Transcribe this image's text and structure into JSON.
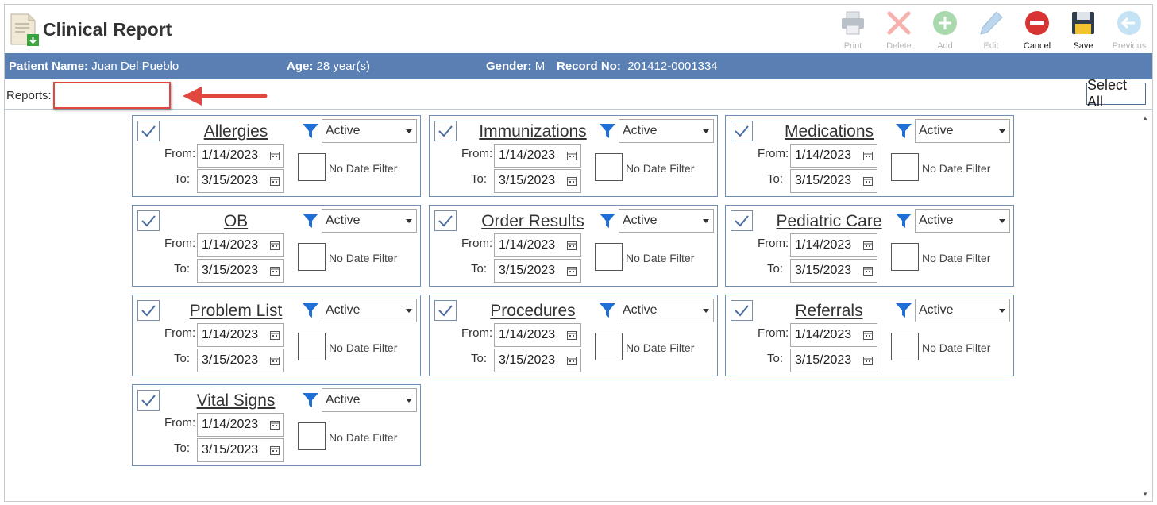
{
  "app": {
    "title": "Clinical Report"
  },
  "toolbar": {
    "buttons": [
      {
        "label": "Print",
        "icon": "printer-icon",
        "enabled": false
      },
      {
        "label": "Delete",
        "icon": "delete-x-icon",
        "enabled": false
      },
      {
        "label": "Add",
        "icon": "add-plus-icon",
        "enabled": false
      },
      {
        "label": "Edit",
        "icon": "pencil-icon",
        "enabled": false
      },
      {
        "label": "Cancel",
        "icon": "cancel-icon",
        "enabled": true
      },
      {
        "label": "Save",
        "icon": "floppy-disk-icon",
        "enabled": true
      },
      {
        "label": "Previous",
        "icon": "back-arrow-icon",
        "enabled": false
      }
    ]
  },
  "patient": {
    "name_label": "Patient Name:",
    "name": "Juan Del Pueblo",
    "age_label": "Age:",
    "age": "28 year(s)",
    "gender_label": "Gender:",
    "gender": "M",
    "record_label": "Record No:",
    "record": "201412-0001334"
  },
  "reports": {
    "label": "Reports:",
    "value": "",
    "select_all": "Select All"
  },
  "from_label": "From:",
  "to_label": "To:",
  "no_date_filter_label": "No Date Filter",
  "cards": [
    {
      "title": "Allergies",
      "checked": true,
      "status": "Active",
      "from": "1/14/2023",
      "to": "3/15/2023"
    },
    {
      "title": "Immunizations",
      "checked": true,
      "status": "Active",
      "from": "1/14/2023",
      "to": "3/15/2023"
    },
    {
      "title": "Medications",
      "checked": true,
      "status": "Active",
      "from": "1/14/2023",
      "to": "3/15/2023"
    },
    {
      "title": "OB",
      "checked": true,
      "status": "Active",
      "from": "1/14/2023",
      "to": "3/15/2023"
    },
    {
      "title": "Order Results",
      "checked": true,
      "status": "Active",
      "from": "1/14/2023",
      "to": "3/15/2023"
    },
    {
      "title": "Pediatric Care",
      "checked": true,
      "status": "Active",
      "from": "1/14/2023",
      "to": "3/15/2023"
    },
    {
      "title": "Problem List",
      "checked": true,
      "status": "Active",
      "from": "1/14/2023",
      "to": "3/15/2023"
    },
    {
      "title": "Procedures",
      "checked": true,
      "status": "Active",
      "from": "1/14/2023",
      "to": "3/15/2023"
    },
    {
      "title": "Referrals",
      "checked": true,
      "status": "Active",
      "from": "1/14/2023",
      "to": "3/15/2023"
    },
    {
      "title": "Vital Signs",
      "checked": true,
      "status": "Active",
      "from": "1/14/2023",
      "to": "3/15/2023"
    }
  ],
  "colors": {
    "header_bar": "#5a7fb3",
    "card_border": "#6f8fb5",
    "highlight": "#e0473f",
    "filter": "#1f6fd6"
  }
}
